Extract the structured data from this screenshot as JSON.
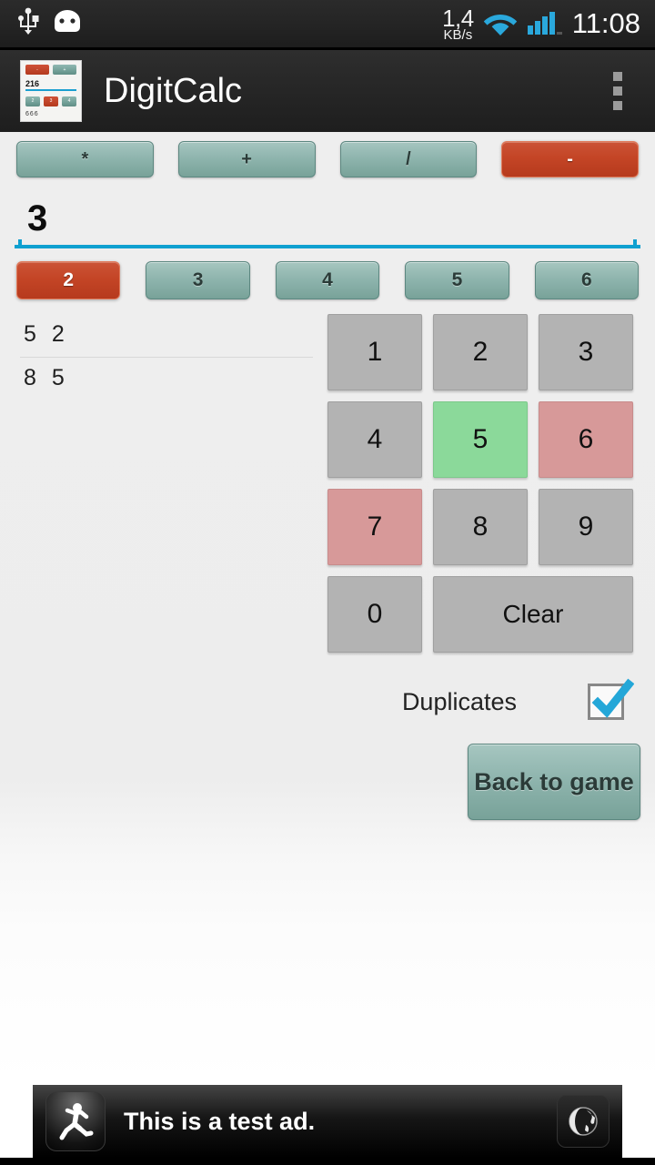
{
  "status_bar": {
    "usb_icon": "usb-icon",
    "android_icon": "android-head-icon",
    "data_rate_value": "1,4",
    "data_rate_unit": "KB/s",
    "wifi_icon": "wifi-icon",
    "signal_icon": "cellular-signal-icon",
    "clock": "11:08"
  },
  "action_bar": {
    "app_title": "DigitCalc",
    "overflow_icon": "overflow-menu-icon",
    "app_icon": {
      "top_left_label": "-",
      "top_right_label": "+",
      "number": "216",
      "mid_labels": [
        "2",
        "3",
        "4"
      ],
      "footer": "666"
    }
  },
  "operators": {
    "items": [
      {
        "label": "*",
        "selected": false
      },
      {
        "label": "+",
        "selected": false
      },
      {
        "label": "/",
        "selected": false
      },
      {
        "label": "-",
        "selected": true
      }
    ]
  },
  "input_field": {
    "value": "3",
    "placeholder": "",
    "underline_color": "#0fa0d0"
  },
  "digit_counts": {
    "items": [
      {
        "label": "2",
        "selected": true
      },
      {
        "label": "3",
        "selected": false
      },
      {
        "label": "4",
        "selected": false
      },
      {
        "label": "5",
        "selected": false
      },
      {
        "label": "6",
        "selected": false
      }
    ]
  },
  "results_list": {
    "items": [
      "5 2",
      "8 5"
    ]
  },
  "keypad": {
    "keys": [
      {
        "label": "1",
        "state": "normal"
      },
      {
        "label": "2",
        "state": "normal"
      },
      {
        "label": "3",
        "state": "normal"
      },
      {
        "label": "4",
        "state": "normal"
      },
      {
        "label": "5",
        "state": "green"
      },
      {
        "label": "6",
        "state": "pink"
      },
      {
        "label": "7",
        "state": "pink"
      },
      {
        "label": "8",
        "state": "normal"
      },
      {
        "label": "9",
        "state": "normal"
      },
      {
        "label": "0",
        "state": "normal"
      },
      {
        "label": "Clear",
        "state": "wide"
      }
    ]
  },
  "duplicates": {
    "label": "Duplicates",
    "checked": true,
    "check_color": "#24a7d8"
  },
  "back_button": {
    "label": "Back to game"
  },
  "ad_banner": {
    "icon": "running-person-icon",
    "text": "This is a test ad.",
    "action_icon": "globe-icon"
  },
  "colors": {
    "teal": "#8fb5ae",
    "red": "#c44526",
    "green_key": "#8bd99a",
    "pink_key": "#d79999",
    "gray_key": "#b3b3b3",
    "accent": "#0fa0d0"
  }
}
